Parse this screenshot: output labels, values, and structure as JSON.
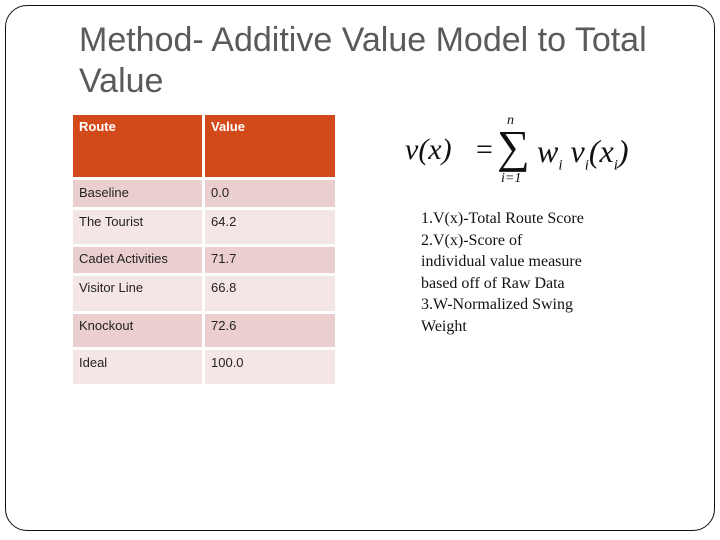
{
  "slide": {
    "title": "Method- Additive Value Model to Total Value"
  },
  "table": {
    "headers": [
      "Route",
      "Value"
    ],
    "rows": [
      {
        "route": "Baseline",
        "value": "0.0"
      },
      {
        "route": "The Tourist",
        "value": "64.2"
      },
      {
        "route": "Cadet Activities",
        "value": "71.7"
      },
      {
        "route": "Visitor Line",
        "value": "66.8"
      },
      {
        "route": "Knockout",
        "value": "72.6"
      },
      {
        "route": "Ideal",
        "value": "100.0"
      }
    ]
  },
  "formula": {
    "lhs": "v(x)",
    "equals": "=",
    "sigma": "∑",
    "upper_limit": "n",
    "lower_limit": "i=1",
    "rhs_w": "w",
    "rhs_w_sub": "i",
    "rhs_v": "v",
    "rhs_v_sub": "i",
    "rhs_open": "(x",
    "rhs_x_sub": "i",
    "rhs_close": ")"
  },
  "notes": {
    "lines": [
      "1.V(x)-Total Route Score",
      "2.V(x)-Score of",
      "individual value measure",
      "based off of Raw Data",
      "3.W-Normalized Swing",
      "Weight"
    ]
  },
  "colors": {
    "header_bg": "#D24A1A",
    "row_dark": "#EBCECE",
    "row_light": "#F5E6E6",
    "title_text": "#5a5a5a"
  }
}
